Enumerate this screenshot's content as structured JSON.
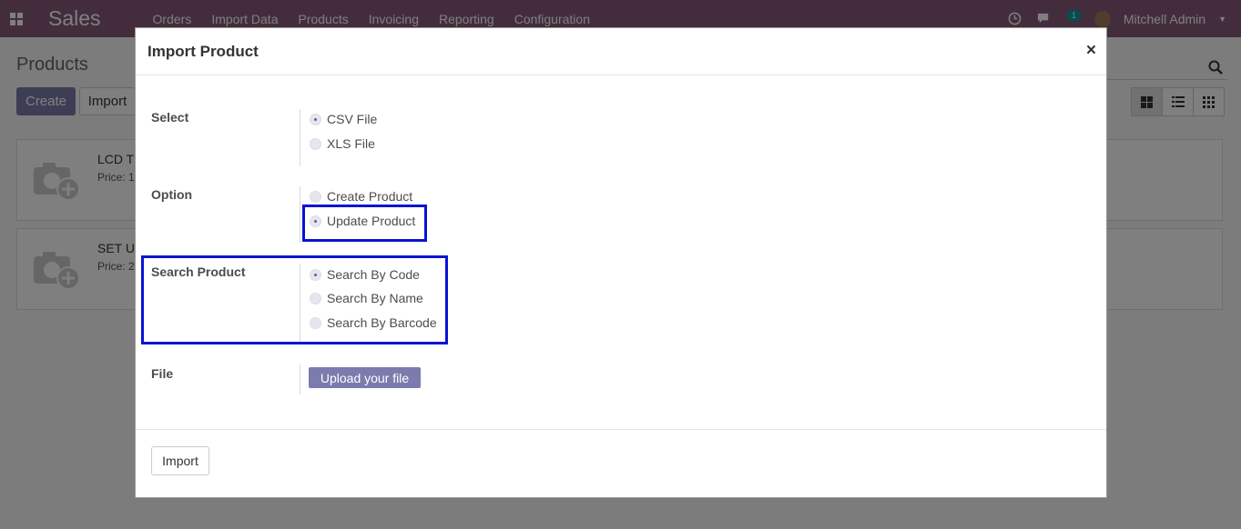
{
  "navbar": {
    "app_name": "Sales",
    "menu": [
      "Orders",
      "Import Data",
      "Products",
      "Invoicing",
      "Reporting",
      "Configuration"
    ],
    "message_count": "1",
    "user": "Mitchell Admin"
  },
  "control_panel": {
    "title": "Products",
    "create_label": "Create",
    "import_label": "Import"
  },
  "kanban": [
    {
      "name": "LCD T",
      "price": "Price: 1"
    },
    {
      "name": "SET U",
      "price": "Price: 2"
    }
  ],
  "modal": {
    "title": "Import Product",
    "close": "×",
    "fields": {
      "select": {
        "label": "Select",
        "options": [
          {
            "label": "CSV File",
            "checked": true
          },
          {
            "label": "XLS File",
            "checked": false
          }
        ]
      },
      "option": {
        "label": "Option",
        "options": [
          {
            "label": "Create Product",
            "checked": false
          },
          {
            "label": "Update Product",
            "checked": true
          }
        ]
      },
      "search": {
        "label": "Search Product",
        "options": [
          {
            "label": "Search By Code",
            "checked": true
          },
          {
            "label": "Search By Name",
            "checked": false
          },
          {
            "label": "Search By Barcode",
            "checked": false
          }
        ]
      },
      "file": {
        "label": "File",
        "upload_label": "Upload your file"
      }
    },
    "footer": {
      "import_label": "Import"
    }
  },
  "colors": {
    "navbar": "#875a7b",
    "primary": "#7c7bad",
    "highlight": "#0a14d2"
  }
}
